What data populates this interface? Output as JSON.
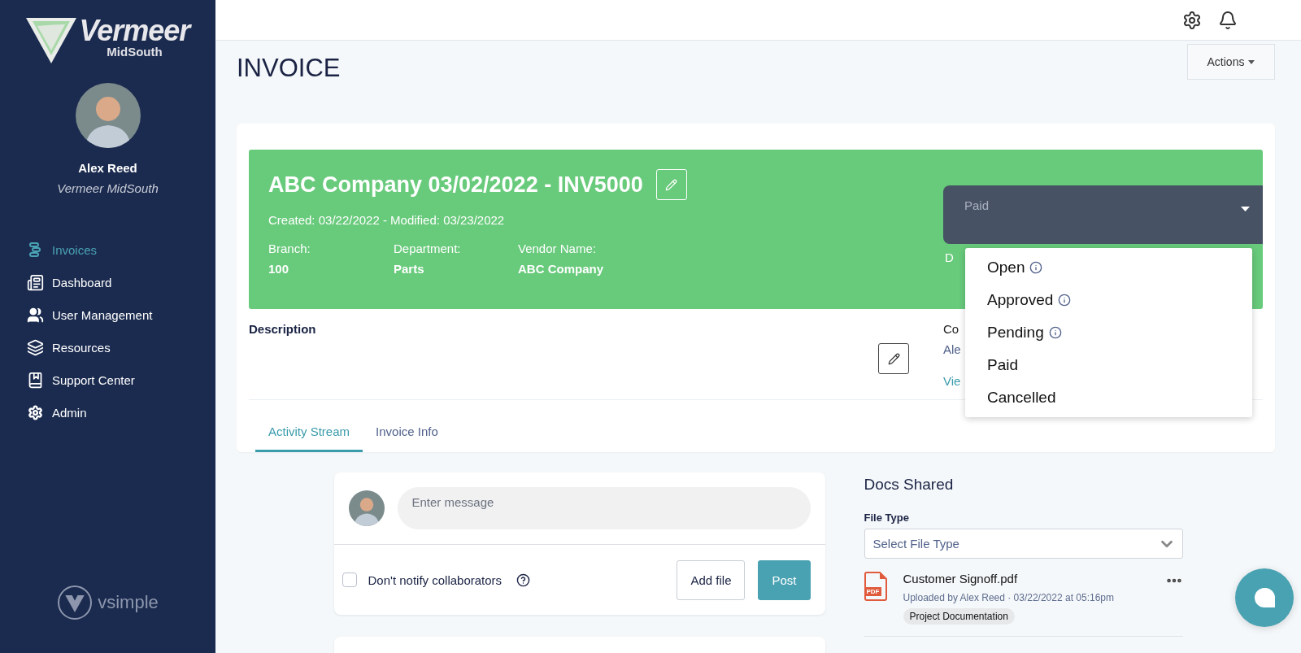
{
  "brand": {
    "name": "Vermeer",
    "region": "MidSouth"
  },
  "user": {
    "name": "Alex Reed",
    "company": "Vermeer MidSouth"
  },
  "nav": [
    {
      "label": "Invoices",
      "selected": true
    },
    {
      "label": "Dashboard",
      "selected": false
    },
    {
      "label": "User Management",
      "selected": false
    },
    {
      "label": "Resources",
      "selected": false
    },
    {
      "label": "Support Center",
      "selected": false
    },
    {
      "label": "Admin",
      "selected": false
    }
  ],
  "footer_brand": "vsimple",
  "page": {
    "title": "INVOICE",
    "actions": "Actions"
  },
  "invoice": {
    "title": "ABC Company 03/02/2022 - INV5000",
    "dates": "Created: 03/22/2022 - Modified: 03/23/2022",
    "fields": [
      {
        "label": "Branch:",
        "value": "100"
      },
      {
        "label": "Department:",
        "value": "Parts"
      },
      {
        "label": "Vendor Name:",
        "value": "ABC Company"
      }
    ],
    "status": {
      "value": "Paid",
      "expanded": true,
      "options": [
        {
          "label": "Open",
          "info": true
        },
        {
          "label": "Approved",
          "info": true
        },
        {
          "label": "Pending",
          "info": true
        },
        {
          "label": "Paid",
          "info": false
        },
        {
          "label": "Cancelled",
          "info": false
        }
      ]
    },
    "status_note": "D"
  },
  "description": {
    "label": "Description"
  },
  "side_info": [
    {
      "kind": "label",
      "text": "Co"
    },
    {
      "kind": "value",
      "text": "Ale"
    },
    {
      "kind": "link",
      "text": "Vie"
    }
  ],
  "tabs": [
    {
      "label": "Activity Stream",
      "selected": true
    },
    {
      "label": "Invoice Info",
      "selected": false
    }
  ],
  "composer": {
    "placeholder": "Enter message",
    "notify": {
      "label": "Don't notify collaborators",
      "checked": false
    },
    "buttons": [
      {
        "label": "Add file",
        "kind": "secondary"
      },
      {
        "label": "Post",
        "kind": "primary"
      }
    ]
  },
  "docs": {
    "title": "Docs Shared",
    "filter": {
      "label": "File Type",
      "placeholder": "Select File Type"
    },
    "files": [
      {
        "name": "Customer Signoff.pdf",
        "type": "PDF",
        "meta": "Uploaded by Alex Reed · 03/22/2022 at 05:16pm",
        "tag": "Project Documentation"
      }
    ]
  }
}
